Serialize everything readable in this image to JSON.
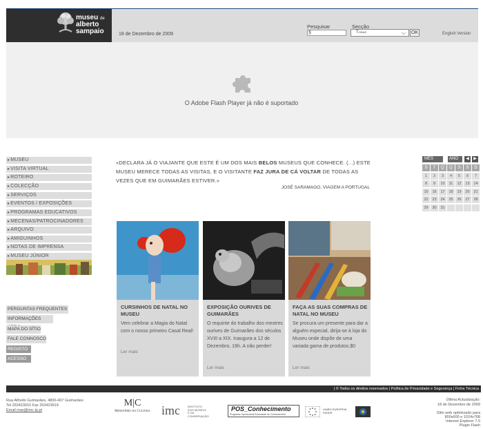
{
  "header": {
    "logo_line1": "museu",
    "logo_line1_small": "de",
    "logo_line2": "alberto",
    "logo_line3": "sampaio",
    "date": "18 de Dezembro de 2009",
    "search_label": "Pesquisar",
    "search_value": "§",
    "section_label": "Secção",
    "section_value": "Todas",
    "ok_label": "OK",
    "english_label": "English Version"
  },
  "flash": {
    "message": "O Adobe Flash Player já não é suportado"
  },
  "menu": {
    "items": [
      "MUSEU",
      "VISITA VIRTUAL",
      "ROTEIRO",
      "COLECÇÃO",
      "SERVIÇOS",
      "EVENTOS / EXPOSIÇÕES",
      "PROGRAMAS EDUCATIVOS",
      "MECENAS/PATROCINADORES",
      "ARQUIVO",
      "AMIGUINHOS",
      "NOTAS DE IMPRENSA",
      "MUSEU JÚNIOR"
    ],
    "secondary": [
      "PERGUNTAS FREQUENTES",
      "INFORMAÇÕES ÚTEIS",
      "MAPA DO SÍTIO",
      "FALE CONNOSCO"
    ],
    "registo": "REGISTO",
    "acesso": "ACESSO"
  },
  "quote": {
    "part1": "«DECLARA JÁ O VIAJANTE QUE ESTE É UM DOS MAIS ",
    "bold1": "BELOS",
    "part2": " MUSEUS QUE CONHECE. (...) ESTE MUSEU MERECE TODAS AS VISITAS, E O VISITANTE ",
    "bold2": "FAZ JURA DE CÁ VOLTAR",
    "part3": " DE TODAS AS VEZES QUE EM GUIMARÃES ESTIVER.»",
    "author": "JOSÉ SARAMAGO, VIAGEM A PORTUGAL"
  },
  "calendar": {
    "month_label": "MÊS",
    "year_label": "ANO",
    "weekdays": [
      "S",
      "T",
      "Q",
      "Q",
      "S",
      "S",
      "D"
    ],
    "days": [
      "1",
      "2",
      "3",
      "4",
      "5",
      "6",
      "7",
      "8",
      "9",
      "10",
      "11",
      "12",
      "13",
      "14",
      "15",
      "16",
      "17",
      "18",
      "19",
      "20",
      "21",
      "22",
      "23",
      "24",
      "25",
      "26",
      "27",
      "28",
      "29",
      "30",
      "31",
      "",
      "",
      "",
      ""
    ]
  },
  "cards": [
    {
      "title": "CURSINHOS DE NATAL NO MUSEU",
      "text": "Vem celebrar a Magia do Natal com o nosso primeiro Casal Real!",
      "more": "Ler mais"
    },
    {
      "title": "EXPOSIÇÃO OURIVES DE GUIMARÃES",
      "text": "O requinte do trabalho dos mestres ourives de Guimarães dos séculos XVIII a XIX. Inaugura a 12 de Dezembro, 16h. A não perder!",
      "more": "Ler mais"
    },
    {
      "title": "FAÇA AS SUAS COMPRAS DE NATAL NO MUSEU",
      "text": "Se procura um presente para dar a alguém especial, dirija-se à loja do Museu onde dispõe de uma variada gama de produtos.$0",
      "more": "Ler mais"
    }
  ],
  "footer": {
    "links": "| © Todos os direitos reservados | Política de Privacidade e Segurança | Ficha Técnica",
    "address": "Rua Alfredo Guimarães, 4800-407 Guimarães",
    "tel": "Tel 253423910 Fax 253423919",
    "email": "Email mas@imc-ip.pt",
    "updated1": "Última Actualização:",
    "updated2": "18 de Dezembro de 2009",
    "opt1": "Sítio web optimizado para",
    "opt2": "800x600 e 1024x768",
    "opt3": "Internet Explorer 7.0",
    "opt4": "Plugin Flash",
    "logo_mc": "M|C",
    "logo_ministerio": "Ministério da Cultura",
    "logo_imc": "imc",
    "logo_imc_sub1": "INSTITUTO",
    "logo_imc_sub2": "DOS MUSEUS",
    "logo_imc_sub3": "E DA CONSERVAÇÃO",
    "logo_pos": "POS_Conhecimento",
    "logo_pos_sub": "Programa Operacional Sociedade do Conhecimento",
    "logo_ue1": "UNIÃO EUROPEIA",
    "logo_ue2": "FEDER"
  },
  "colors": {
    "dark": "#2e2e2e",
    "light_gray": "#dddddd",
    "accent_line": "#1f4a7a"
  }
}
